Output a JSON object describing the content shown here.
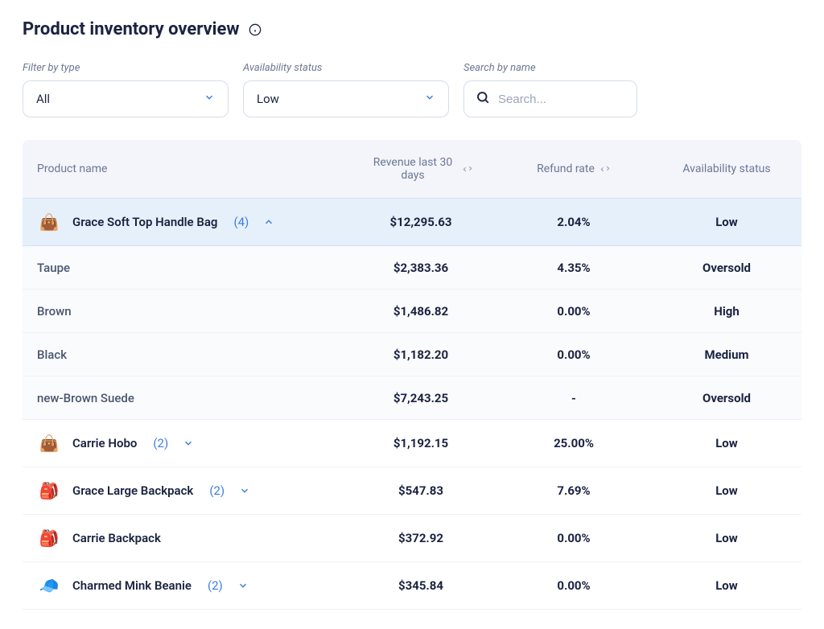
{
  "title": "Product inventory overview",
  "filters": {
    "type": {
      "label": "Filter by type",
      "value": "All"
    },
    "availability": {
      "label": "Availability status",
      "value": "Low"
    },
    "search": {
      "label": "Search by name",
      "placeholder": "Search..."
    }
  },
  "columns": {
    "name": "Product name",
    "revenue": "Revenue last 30 days",
    "refund": "Refund rate",
    "availability": "Availability status"
  },
  "rows": [
    {
      "kind": "parent",
      "expanded": true,
      "thumb": "👜",
      "name": "Grace Soft Top Handle Bag",
      "variantCount": "(4)",
      "revenue": "$12,295.63",
      "refund": "2.04%",
      "availability": "Low"
    },
    {
      "kind": "child",
      "name": "Taupe",
      "revenue": "$2,383.36",
      "refund": "4.35%",
      "availability": "Oversold"
    },
    {
      "kind": "child",
      "name": "Brown",
      "revenue": "$1,486.82",
      "refund": "0.00%",
      "availability": "High"
    },
    {
      "kind": "child",
      "name": "Black",
      "revenue": "$1,182.20",
      "refund": "0.00%",
      "availability": "Medium"
    },
    {
      "kind": "child",
      "name": "new-Brown Suede",
      "revenue": "$7,243.25",
      "refund": "-",
      "availability": "Oversold"
    },
    {
      "kind": "parent",
      "expanded": false,
      "thumb": "👜",
      "name": "Carrie Hobo",
      "variantCount": "(2)",
      "revenue": "$1,192.15",
      "refund": "25.00%",
      "availability": "Low"
    },
    {
      "kind": "parent",
      "expanded": false,
      "thumb": "🎒",
      "name": "Grace Large Backpack",
      "variantCount": "(2)",
      "revenue": "$547.83",
      "refund": "7.69%",
      "availability": "Low"
    },
    {
      "kind": "parent",
      "expanded": false,
      "thumb": "🎒",
      "name": "Carrie Backpack",
      "revenue": "$372.92",
      "refund": "0.00%",
      "availability": "Low"
    },
    {
      "kind": "parent",
      "expanded": false,
      "thumb": "🧢",
      "name": "Charmed Mink Beanie",
      "variantCount": "(2)",
      "revenue": "$345.84",
      "refund": "0.00%",
      "availability": "Low"
    }
  ]
}
